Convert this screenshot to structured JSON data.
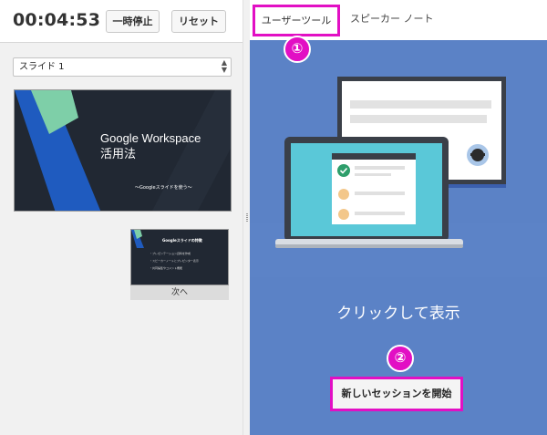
{
  "timer": {
    "time": "00:04:53",
    "pause_label": "一時停止",
    "reset_label": "リセット"
  },
  "slide_selector": {
    "selected": "スライド 1"
  },
  "current_slide": {
    "title": "Google Workspace\n活用法",
    "subtitle": "～Googleスライドを使う～"
  },
  "next_slide": {
    "title": "Googleスライドの特徴",
    "bullets": [
      "・プレゼンテーション資料を作成",
      "・スピーカーノートとプレゼンター表示",
      "・共同編集やコメント機能"
    ],
    "label": "次へ"
  },
  "tabs": [
    {
      "label": "ユーザーツール",
      "active": true
    },
    {
      "label": "スピーカー ノート",
      "active": false
    }
  ],
  "annotations": {
    "badge_1": "①",
    "badge_2": "②",
    "highlight_color": "#e20fc4"
  },
  "user_tools": {
    "prompt": "クリックして表示",
    "start_session_label": "新しいセッションを開始"
  },
  "colors": {
    "panel_blue": "#5b82c6",
    "slide_dark": "#212833",
    "slide_accent_green": "#7ecfa8",
    "slide_accent_blue": "#1f5bbf"
  }
}
